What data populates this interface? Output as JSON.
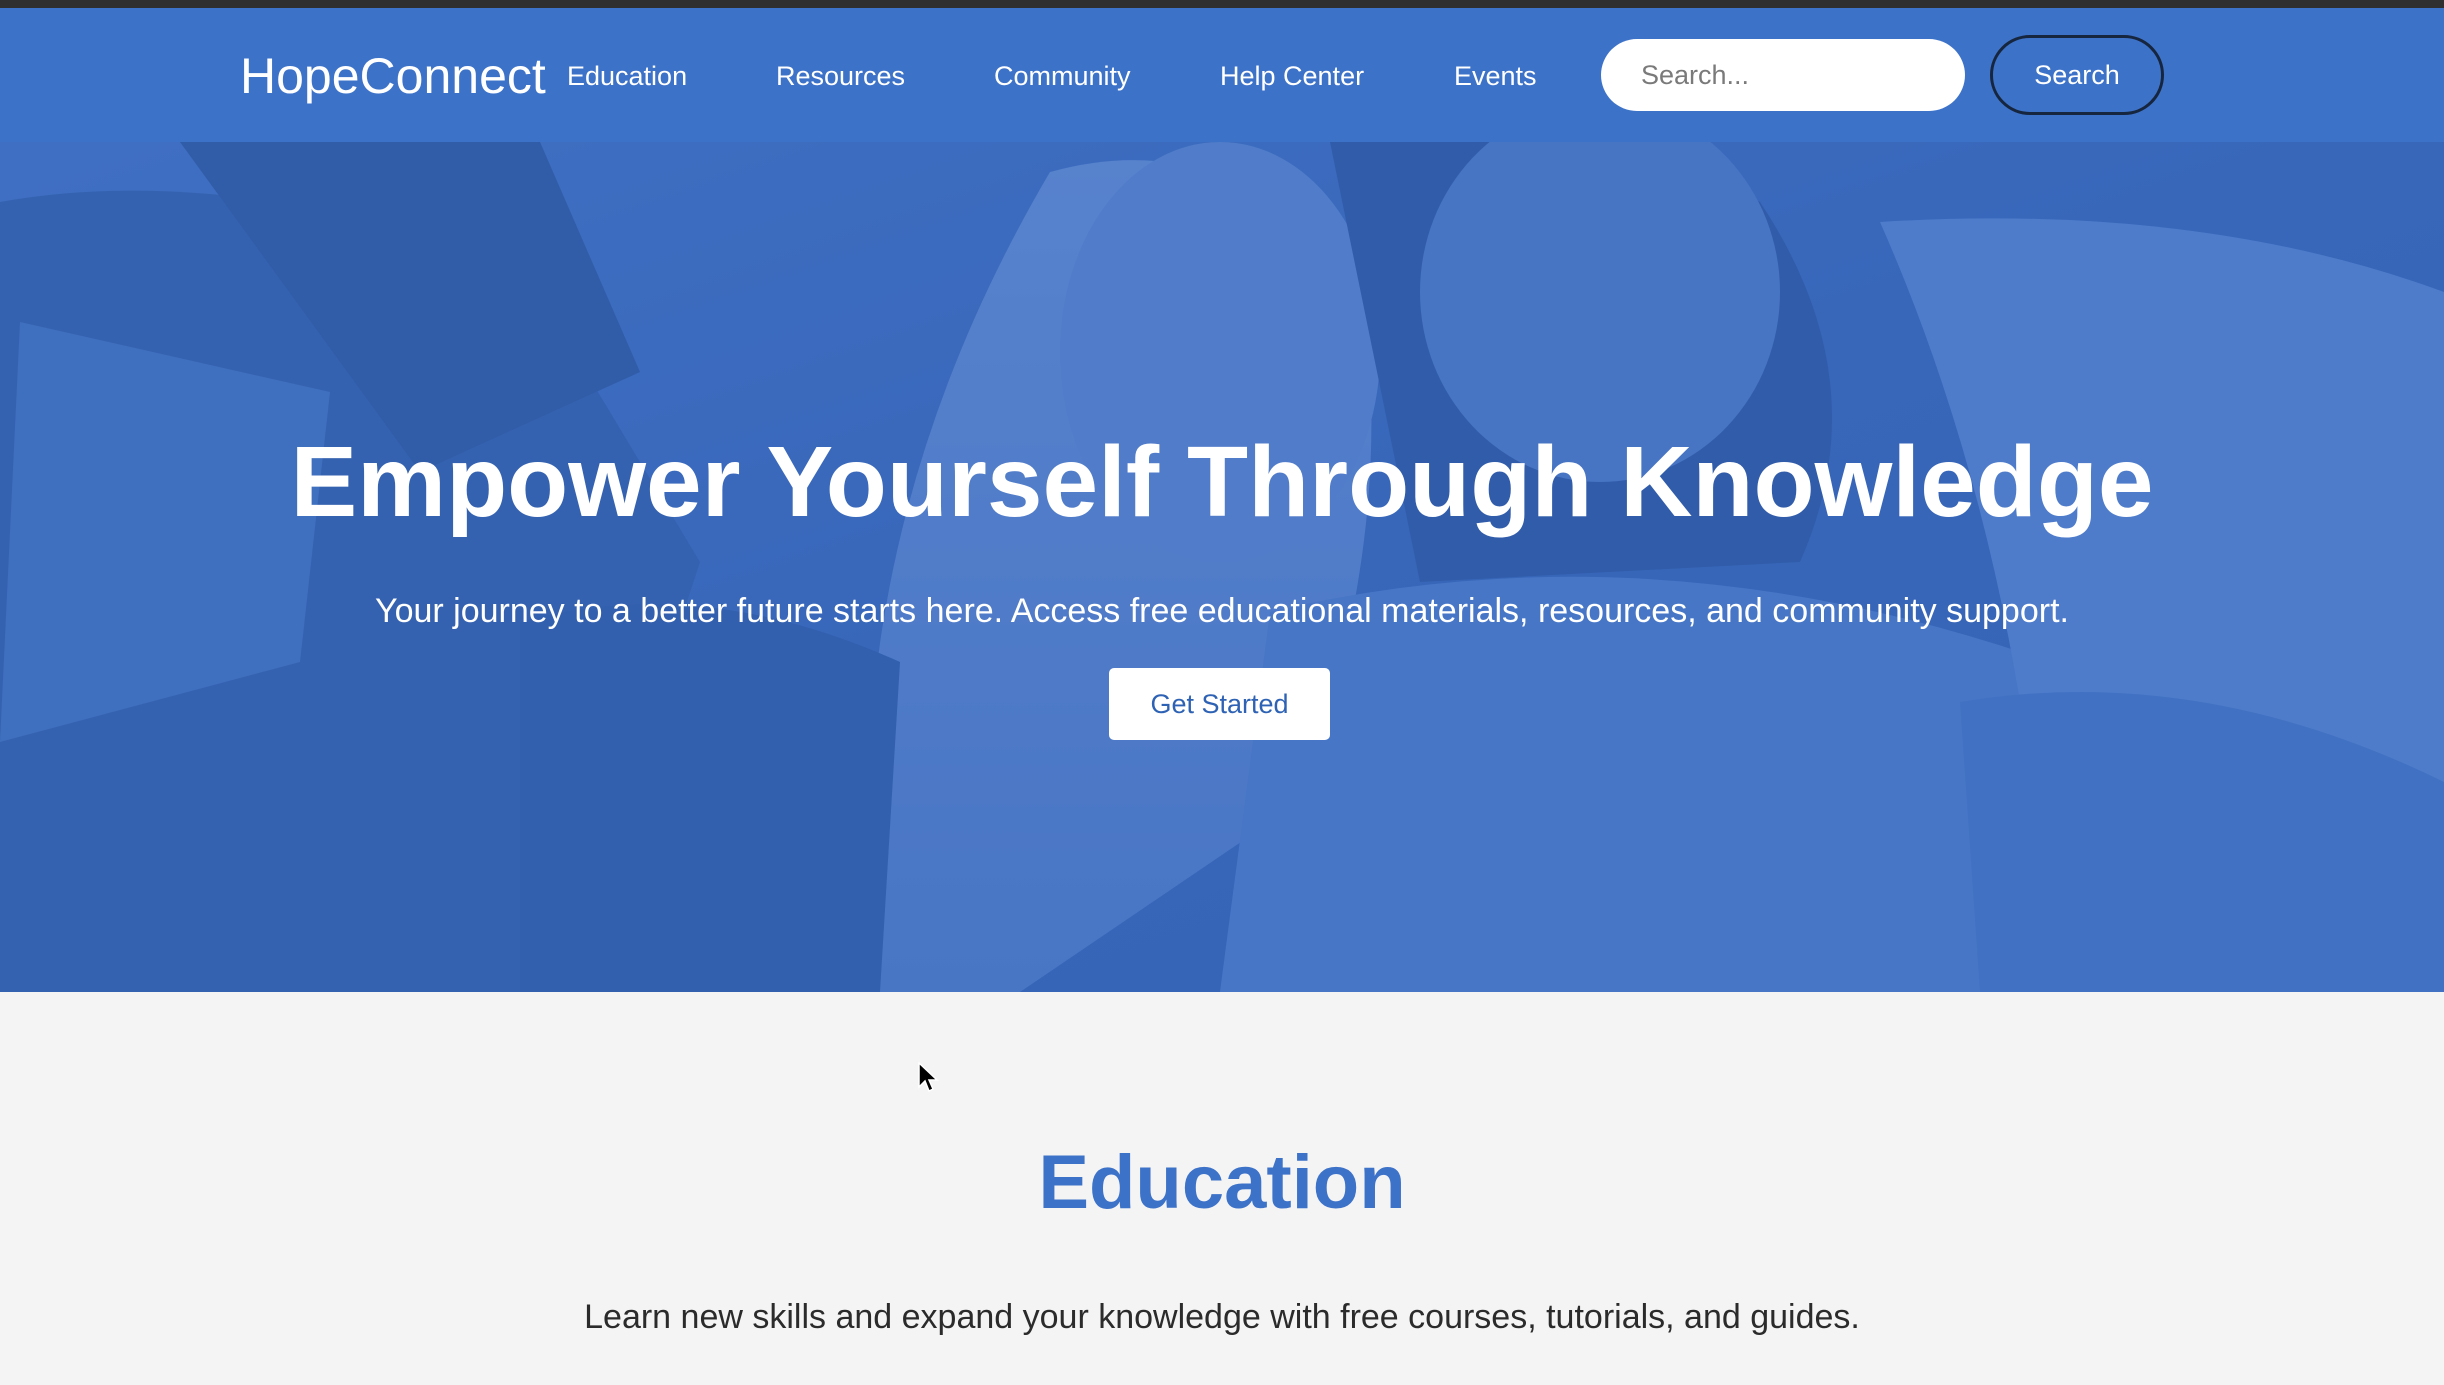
{
  "header": {
    "logo": "HopeConnect",
    "nav": [
      {
        "label": "Education"
      },
      {
        "label": "Resources"
      },
      {
        "label": "Community"
      },
      {
        "label": "Help Center"
      },
      {
        "label": "Events"
      }
    ],
    "search": {
      "placeholder": "Search...",
      "value": "",
      "button_label": "Search"
    }
  },
  "hero": {
    "title": "Empower Yourself Through Knowledge",
    "subtitle": "Your journey to a better future starts here. Access free educational materials, resources, and community support.",
    "cta_label": "Get Started"
  },
  "education": {
    "title": "Education",
    "description": "Learn new skills and expand your knowledge with free courses, tutorials, and guides."
  },
  "colors": {
    "brand_blue": "#3d72c9",
    "dark_strip": "#2f2f2f",
    "page_background": "#f4f4f4",
    "cta_text": "#2e62b4"
  }
}
